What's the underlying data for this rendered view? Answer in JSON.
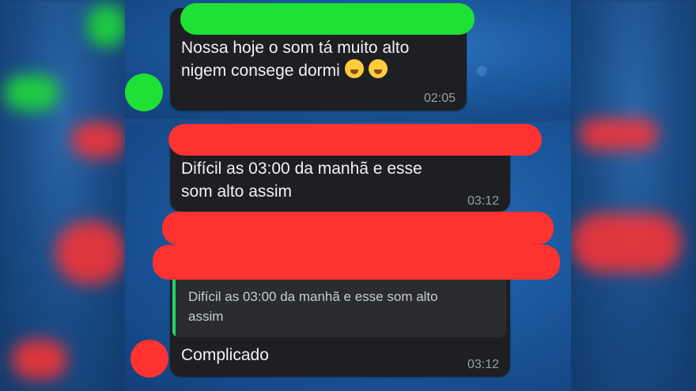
{
  "messages": [
    {
      "text_line1": "Nossa hoje o som tá muito alto",
      "text_line2": "nigem consege dormi",
      "emoji": "yawning-face",
      "time": "02:05"
    },
    {
      "text_line1": "Difícil as 03:00 da manhã e esse",
      "text_line2": "som alto assim",
      "time": "03:12"
    },
    {
      "quote_line1": "Difícil as 03:00 da manhã e esse som alto",
      "quote_line2": "assim",
      "text": "Complicado",
      "time": "03:12"
    }
  ],
  "colors": {
    "bubble_bg": "#1e1f22",
    "redaction_green": "#1fe035",
    "redaction_red": "#ff3232",
    "quote_accent": "#25d366",
    "background_blue": "#1c5aa0"
  }
}
